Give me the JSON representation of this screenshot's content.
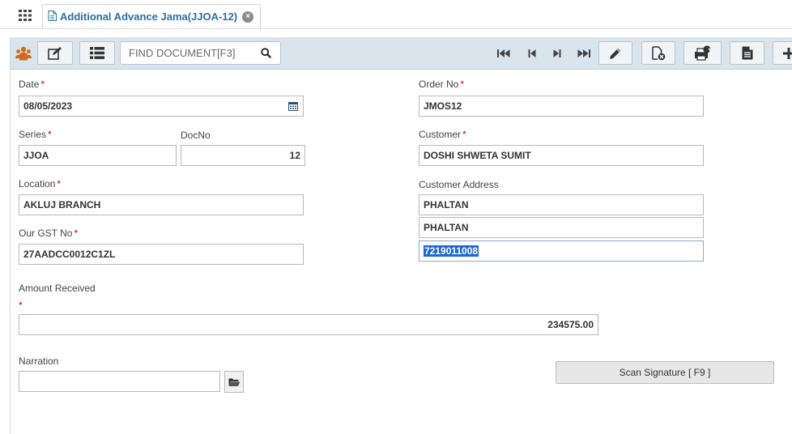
{
  "tab": {
    "title": "Additional Advance Jama(JJOA-12)"
  },
  "toolbar": {
    "find_placeholder": "FIND DOCUMENT[F3]",
    "print_badge": "1"
  },
  "form": {
    "date": {
      "label": "Date",
      "required": "*",
      "value": "08/05/2023"
    },
    "order_no": {
      "label": "Order No",
      "required": "*",
      "value": "JMOS12"
    },
    "series": {
      "label": "Series",
      "required": "*",
      "value": "JJOA"
    },
    "docno": {
      "label": "DocNo",
      "value": "12"
    },
    "customer": {
      "label": "Customer",
      "required": "*",
      "value": "DOSHI SHWETA SUMIT"
    },
    "location": {
      "label": "Location",
      "required": "*",
      "value": "AKLUJ BRANCH"
    },
    "customer_address": {
      "label": "Customer Address",
      "line1": "PHALTAN",
      "line2": "PHALTAN",
      "line3": "7219011008"
    },
    "gst": {
      "label": "Our GST No",
      "required": "*",
      "value": "27AADCC0012C1ZL"
    },
    "amount": {
      "label": "Amount Received",
      "required": "*",
      "value": "234575.00"
    },
    "narration": {
      "label": "Narration",
      "value": ""
    },
    "scan_signature": {
      "label": "Scan Signature [ F9 ]"
    }
  },
  "colors": {
    "accent": "#2a6fa8",
    "toolbar_bg": "#d9e4ec",
    "required": "#cc0000",
    "selection": "#1e68d2"
  }
}
